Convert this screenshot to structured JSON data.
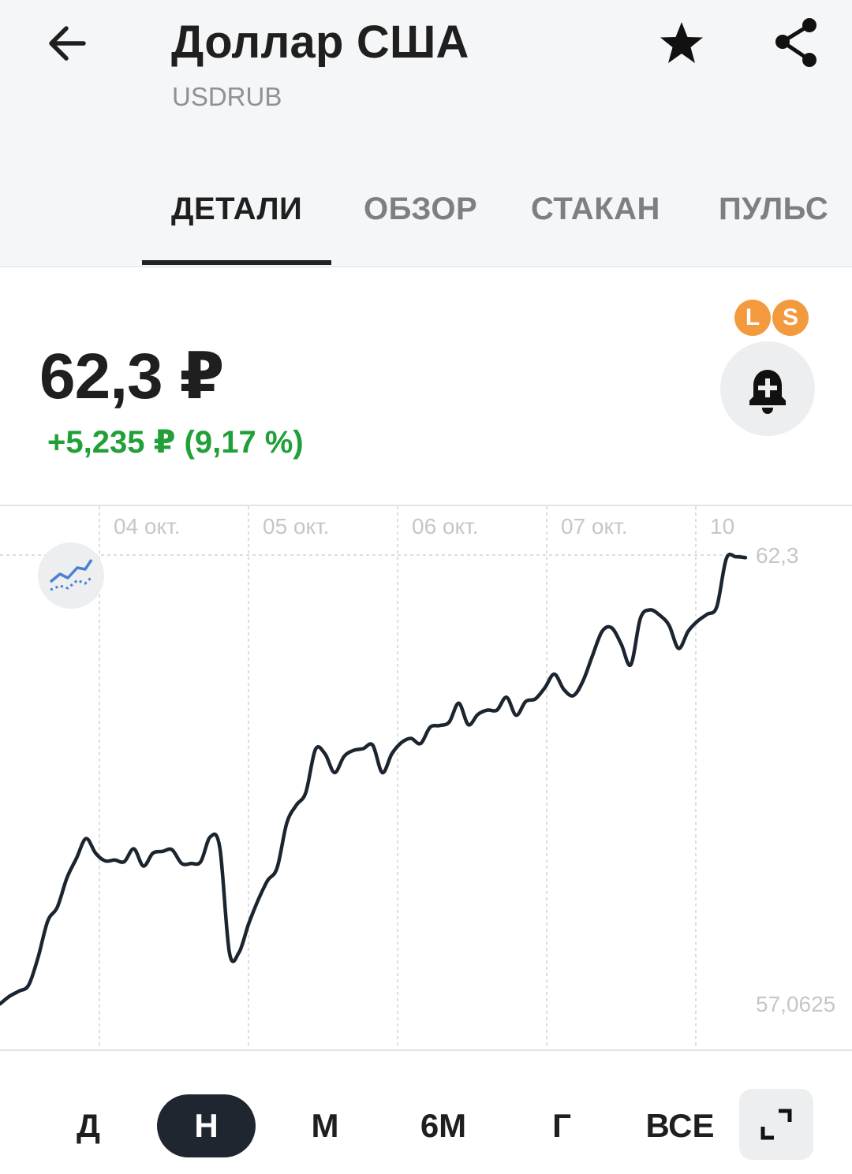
{
  "header": {
    "title": "Доллар США",
    "ticker": "USDRUB",
    "back_icon": "arrow-left-icon",
    "favorite_icon": "star-icon",
    "share_icon": "share-icon"
  },
  "tabs": [
    {
      "label": "ДЕТАЛИ",
      "active": true
    },
    {
      "label": "ОБЗОР",
      "active": false
    },
    {
      "label": "СТАКАН",
      "active": false
    },
    {
      "label": "ПУЛЬС",
      "active": false
    }
  ],
  "quote": {
    "price": "62,3 ₽",
    "change": "+5,235 ₽ (9,17 %)",
    "change_color": "#21a038"
  },
  "badges": {
    "long": "L",
    "short": "S",
    "color": "#f39a3f"
  },
  "alert_icon": "bell-plus-icon",
  "indicator_icon": "trend-indicator-icon",
  "expand_icon": "expand-icon",
  "periods": [
    {
      "label": "Д",
      "active": false
    },
    {
      "label": "Н",
      "active": true
    },
    {
      "label": "М",
      "active": false
    },
    {
      "label": "6М",
      "active": false
    },
    {
      "label": "Г",
      "active": false
    },
    {
      "label": "ВСЕ",
      "active": false
    }
  ],
  "chart_data": {
    "type": "line",
    "x_tick_labels": [
      "04 окт.",
      "05 окт.",
      "06 окт.",
      "07 окт.",
      "10"
    ],
    "y_tick_labels": [
      "62,3",
      "57,0625"
    ],
    "y_range": [
      57.0625,
      62.3
    ],
    "grid": true,
    "line_color": "#1b2530",
    "series": [
      {
        "values": [
          57.06,
          57.15,
          57.21,
          57.28,
          57.61,
          58.03,
          58.19,
          58.53,
          58.76,
          58.99,
          58.82,
          58.73,
          58.74,
          58.72,
          58.87,
          58.67,
          58.82,
          58.84,
          58.86,
          58.7,
          58.7,
          58.72,
          59.01,
          58.88,
          57.66,
          57.66,
          57.99,
          58.27,
          58.5,
          58.65,
          59.17,
          59.38,
          59.53,
          60.03,
          59.98,
          59.76,
          59.95,
          60.02,
          60.04,
          60.08,
          59.76,
          59.98,
          60.11,
          60.16,
          60.1,
          60.29,
          60.31,
          60.35,
          60.57,
          60.32,
          60.44,
          60.49,
          60.49,
          60.64,
          60.43,
          60.59,
          60.62,
          60.75,
          60.91,
          60.73,
          60.66,
          60.83,
          61.13,
          61.41,
          61.45,
          61.26,
          61.02,
          61.56,
          61.66,
          61.6,
          61.48,
          61.21,
          61.41,
          61.53,
          61.61,
          61.7,
          62.26,
          62.28,
          62.27
        ]
      }
    ]
  }
}
